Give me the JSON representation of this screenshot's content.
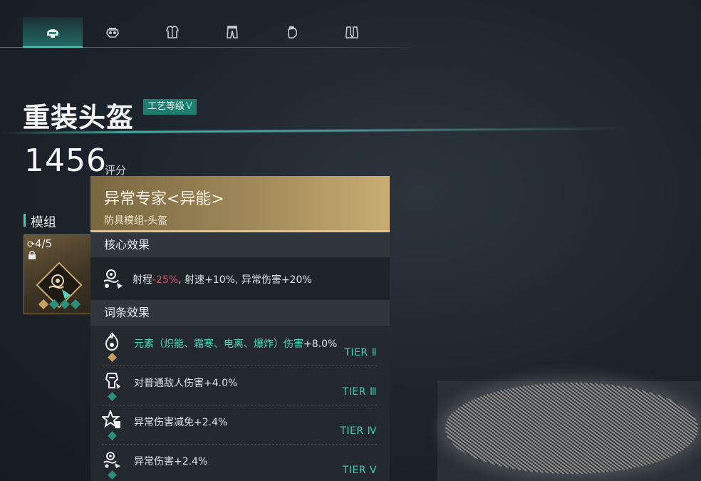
{
  "tabs": [
    {
      "icon": "helmet-icon",
      "active": true
    },
    {
      "icon": "mask-icon",
      "active": false
    },
    {
      "icon": "armor-icon",
      "active": false
    },
    {
      "icon": "pants-icon",
      "active": false
    },
    {
      "icon": "glove-icon",
      "active": false
    },
    {
      "icon": "boots-icon",
      "active": false
    }
  ],
  "item": {
    "title": "重装头盔",
    "craft_label": "工艺等级",
    "craft_level": "V",
    "score": "1456",
    "score_label": "评分"
  },
  "module_section": {
    "label": "模组",
    "count": "4/5"
  },
  "tooltip": {
    "title": "异常专家<异能>",
    "subtitle": "防具模组-头盔",
    "core_heading": "核心效果",
    "core_prefix": "射程",
    "core_negative": "-25%",
    "core_rest": ", 射速+10%, 异常伤害+20%",
    "affix_heading": "词条效果",
    "affixes": [
      {
        "text_highlight": "元素（炽能、霜寒、电离、爆炸）伤害",
        "text_plain": "+8.0%",
        "tier": "TIER Ⅱ",
        "gem_color": "#c9a063"
      },
      {
        "text_highlight": "",
        "text_plain": "对普通敌人伤害+4.0%",
        "tier": "TIER Ⅲ",
        "gem_color": "#2a8f7d"
      },
      {
        "text_highlight": "",
        "text_plain": "异常伤害减免+2.4%",
        "tier": "TIER Ⅳ",
        "gem_color": "#2a8f7d"
      },
      {
        "text_highlight": "",
        "text_plain": "异常伤害+2.4%",
        "tier": "TIER Ⅴ",
        "gem_color": "#2a8f7d"
      }
    ]
  },
  "colors": {
    "accent": "#3fd1bd",
    "negative": "#d0546c",
    "gold": "#c9ad72"
  }
}
